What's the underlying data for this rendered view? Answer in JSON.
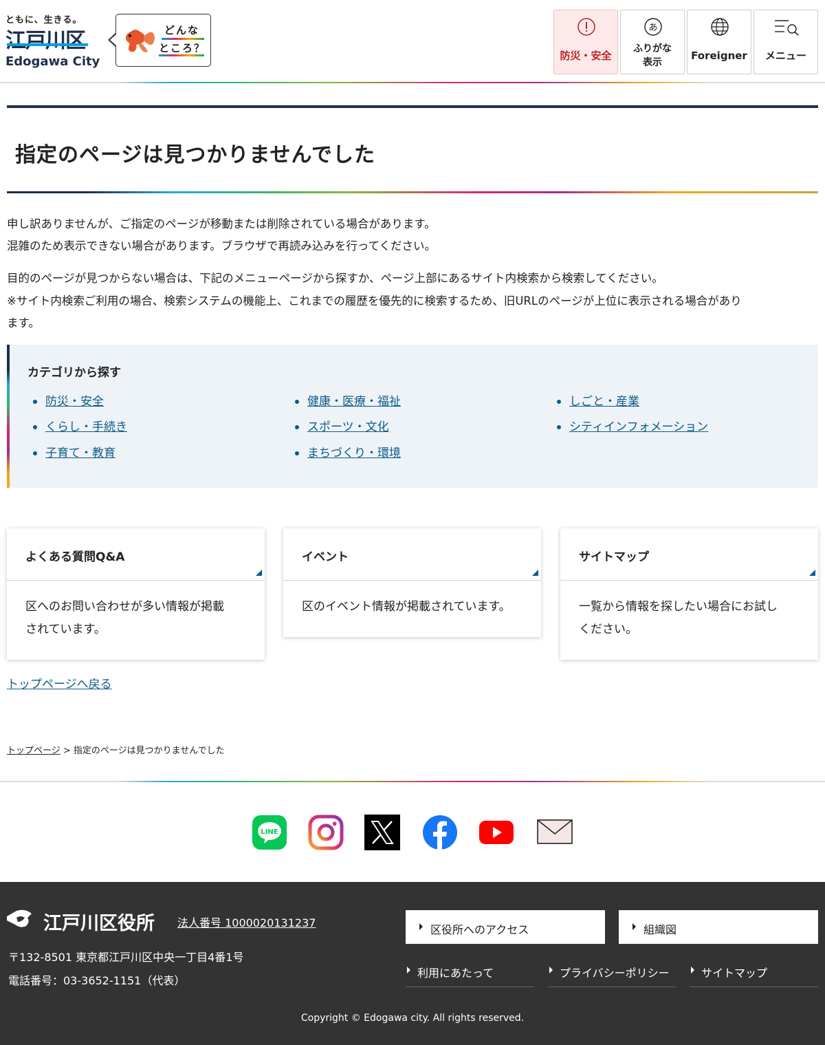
{
  "header": {
    "logo": {
      "tagline": "ともに、生きる。",
      "name": "江戸川区",
      "en": "Edogawa City"
    },
    "bubble": {
      "line1": "どんな",
      "line2": "ところ？"
    },
    "buttons": {
      "disaster": "防災・安全",
      "furigana_line1": "ふりがな",
      "furigana_line2": "表示",
      "foreigner": "Foreigner",
      "menu": "メニュー"
    },
    "colors": {
      "navy": "#1d2f4b",
      "alert": "#c3222c",
      "link": "#0d5b8a"
    }
  },
  "main": {
    "title": "指定のページは見つかりませんでした",
    "para1_line1": "申し訳ありませんが、ご指定のページが移動または削除されている場合があります。",
    "para1_line2": "混雑のため表示できない場合があります。ブラウザで再読み込みを行ってください。",
    "para2_line1": "目的のページが見つからない場合は、下記のメニューページから探すか、ページ上部にあるサイト内検索から検索してください。",
    "para2_line2": "※サイト内検索ご利用の場合、検索システムの機能上、これまでの履歴を優先的に検索するため、旧URLのページが上位に表示される場合があり",
    "para2_line3": "ます。",
    "categories": {
      "title": "カテゴリから探す",
      "items": [
        "防災・安全",
        "健康・医療・福祉",
        "しごと・産業",
        "くらし・手続き",
        "スポーツ・文化",
        "シティインフォメーション",
        "子育て・教育",
        "まちづくり・環境"
      ]
    },
    "cards": [
      {
        "title": "よくある質問Q&A",
        "body_line1": "区へのお問い合わせが多い情報が掲載",
        "body_line2": "されています。"
      },
      {
        "title": "イベント",
        "body_line1": "区のイベント情報が掲載されています。",
        "body_line2": ""
      },
      {
        "title": "サイトマップ",
        "body_line1": "一覧から情報を探したい場合にお試し",
        "body_line2": "ください。"
      }
    ],
    "back_link": "トップページへ戻る",
    "breadcrumb": {
      "home": "トップページ",
      "separator": " > ",
      "current": "指定のページは見つかりませんでした"
    }
  },
  "social": {
    "icons": [
      "line-icon",
      "instagram-icon",
      "x-icon",
      "facebook-icon",
      "youtube-icon",
      "mail-icon"
    ],
    "line_text": "LINE"
  },
  "footer": {
    "name": "江戸川区役所",
    "corporate_number": "法人番号 1000020131237",
    "address": "〒132-8501 東京都江戸川区中央一丁目4番1号",
    "tel": "電話番号：03-3652-1151（代表）",
    "buttons": [
      "区役所へのアクセス",
      "組織図"
    ],
    "links": [
      "利用にあたって",
      "プライバシーポリシー",
      "サイトマップ"
    ],
    "copyright": "Copyright © Edogawa city. All rights reserved."
  }
}
